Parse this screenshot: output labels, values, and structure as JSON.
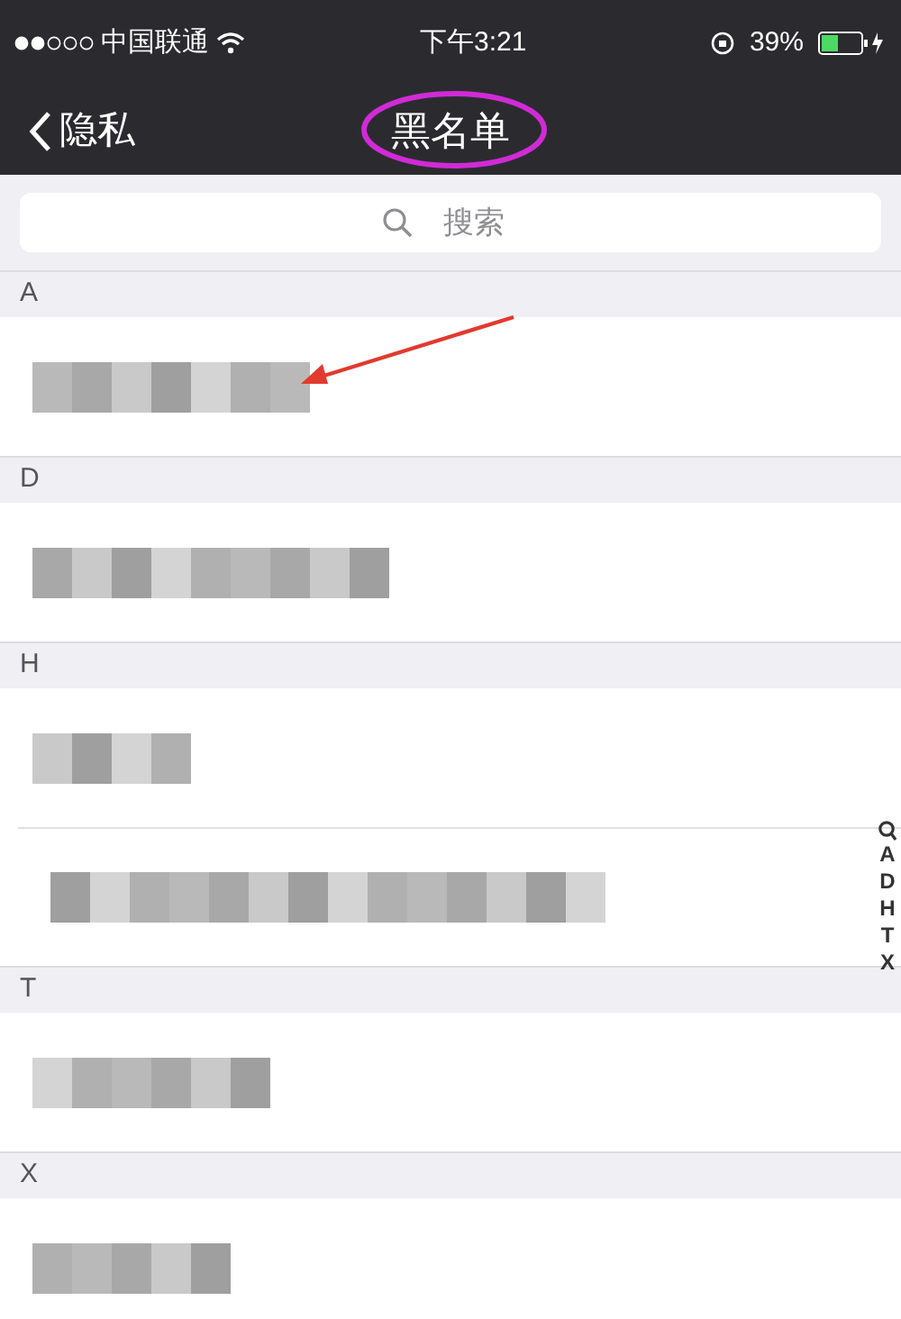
{
  "status_bar": {
    "carrier": "中国联通",
    "time": "下午3:21",
    "battery": "39%"
  },
  "nav": {
    "back": "隐私",
    "title": "黑名单"
  },
  "search": {
    "placeholder": "搜索"
  },
  "sections": [
    {
      "letter": "A"
    },
    {
      "letter": "D"
    },
    {
      "letter": "H"
    },
    {
      "letter": "T"
    },
    {
      "letter": "X"
    }
  ],
  "index": [
    "A",
    "D",
    "H",
    "T",
    "X"
  ]
}
